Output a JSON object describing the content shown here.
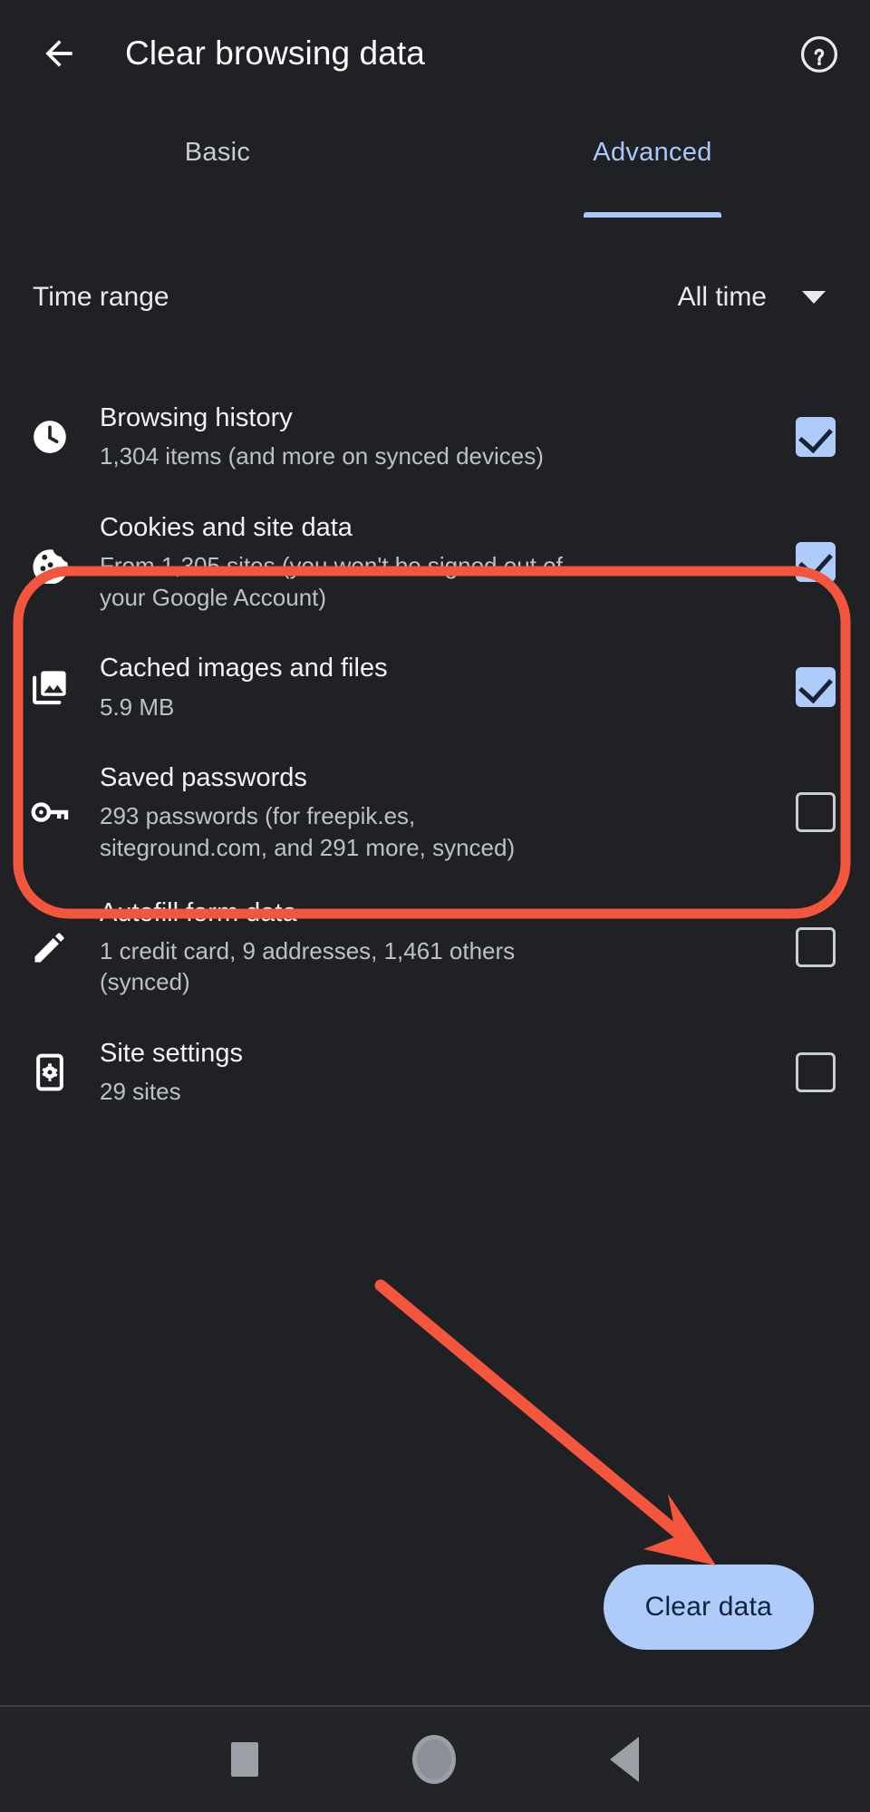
{
  "appbar": {
    "back_icon": "arrow-left-icon",
    "title": "Clear browsing data",
    "help_icon": "help-circle-icon"
  },
  "tabs": [
    {
      "label": "Basic",
      "active": false
    },
    {
      "label": "Advanced",
      "active": true
    }
  ],
  "time_range": {
    "label": "Time range",
    "value": "All time",
    "caret_icon": "chevron-down-icon"
  },
  "items": [
    {
      "icon": "clock-icon",
      "title": "Browsing history",
      "subtitle": "1,304 items (and more on synced devices)",
      "checked": true
    },
    {
      "icon": "cookie-icon",
      "title": "Cookies and site data",
      "subtitle": "From 1,305 sites (you won't be signed out of your Google Account)",
      "checked": true
    },
    {
      "icon": "image-stack-icon",
      "title": "Cached images and files",
      "subtitle": "5.9 MB",
      "checked": true
    },
    {
      "icon": "key-icon",
      "title": "Saved passwords",
      "subtitle": "293 passwords (for freepik.es, siteground.com, and 291 more, synced)",
      "checked": false
    },
    {
      "icon": "pencil-icon",
      "title": "Autofill form data",
      "subtitle": "1 credit card, 9 addresses, 1,461 others (synced)",
      "checked": false
    },
    {
      "icon": "site-settings-icon",
      "title": "Site settings",
      "subtitle": "29 sites",
      "checked": false
    }
  ],
  "cta": {
    "label": "Clear data"
  },
  "navbar": {
    "recents_icon": "square-recents-icon",
    "home_icon": "circle-home-icon",
    "back_icon": "triangle-back-icon"
  },
  "annotations": {
    "highlight_color": "#f4553d",
    "arrow_color": "#f4553d"
  },
  "colors": {
    "background": "#202124",
    "accent_blue": "#a8c7fa",
    "checkbox_blue": "#aecbfa",
    "title_text": "#f1f3f4",
    "subtitle_text": "#bdc1c6"
  }
}
